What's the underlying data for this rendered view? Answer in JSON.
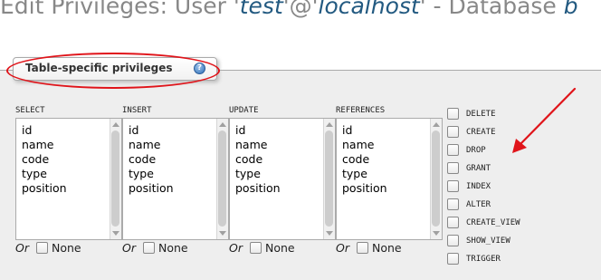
{
  "page": {
    "title_prefix": "Edit Privileges: User '",
    "user": "test",
    "title_mid": "'@'",
    "host": "localhost",
    "title_suffix": "' - Database ",
    "db_partial": "b"
  },
  "fieldset": {
    "legend": "Table-specific privileges",
    "help_icon": "help-icon"
  },
  "columns": [
    {
      "label": "SELECT",
      "options": [
        "id",
        "name",
        "code",
        "type",
        "position"
      ],
      "or": "Or",
      "none": "None"
    },
    {
      "label": "INSERT",
      "options": [
        "id",
        "name",
        "code",
        "type",
        "position"
      ],
      "or": "Or",
      "none": "None"
    },
    {
      "label": "UPDATE",
      "options": [
        "id",
        "name",
        "code",
        "type",
        "position"
      ],
      "or": "Or",
      "none": "None"
    },
    {
      "label": "REFERENCES",
      "options": [
        "id",
        "name",
        "code",
        "type",
        "position"
      ],
      "or": "Or",
      "none": "None"
    }
  ],
  "privileges": [
    "DELETE",
    "CREATE",
    "DROP",
    "GRANT",
    "INDEX",
    "ALTER",
    "CREATE_VIEW",
    "SHOW_VIEW",
    "TRIGGER"
  ],
  "annotation": {
    "color": "#e0141a"
  }
}
